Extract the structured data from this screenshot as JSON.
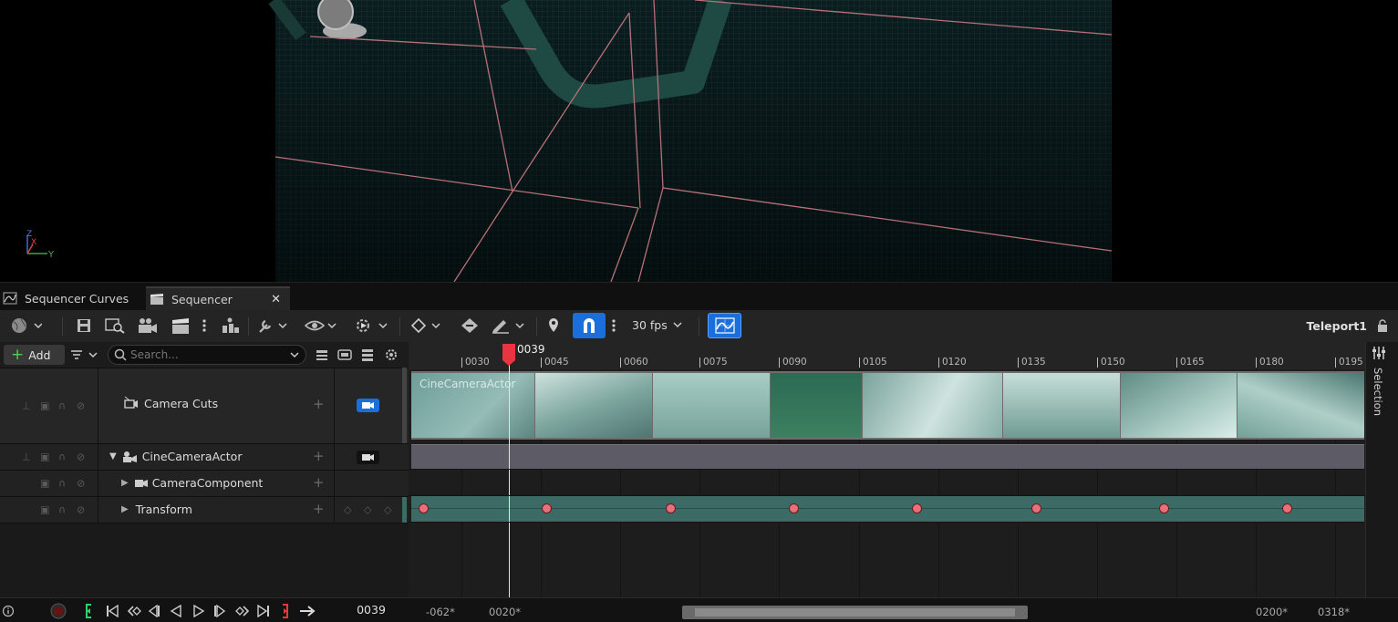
{
  "viewport": {
    "axis_labels": [
      "Z",
      "X",
      "Y"
    ]
  },
  "tabs": [
    {
      "label": "Sequencer Curves",
      "active": false
    },
    {
      "label": "Sequencer",
      "active": true
    }
  ],
  "toolbar": {
    "fps": "30 fps",
    "sequence_name": "Teleport1",
    "accent": "#1a6fdc"
  },
  "outliner": {
    "add_label": "Add",
    "search_placeholder": "Search...",
    "rows": [
      {
        "label": "Camera Cuts"
      },
      {
        "label": "CineCameraActor"
      },
      {
        "label": "CameraComponent"
      },
      {
        "label": "Transform"
      }
    ]
  },
  "timeline": {
    "current_frame": "0039",
    "ticks": [
      "0030",
      "0045",
      "0060",
      "0075",
      "0090",
      "0105",
      "0120",
      "0135",
      "0150",
      "0165",
      "0180",
      "0195"
    ],
    "camera_section_label": "CineCameraActor",
    "keyframe_color": "#e8707a",
    "transform_track_color": "#3c6b66"
  },
  "sidepanel": {
    "label": "Selection"
  },
  "bottombar": {
    "current_frame": "0039",
    "view_start": "-062*",
    "play_start": "0020*",
    "play_end": "0200*",
    "view_end": "0318*"
  }
}
